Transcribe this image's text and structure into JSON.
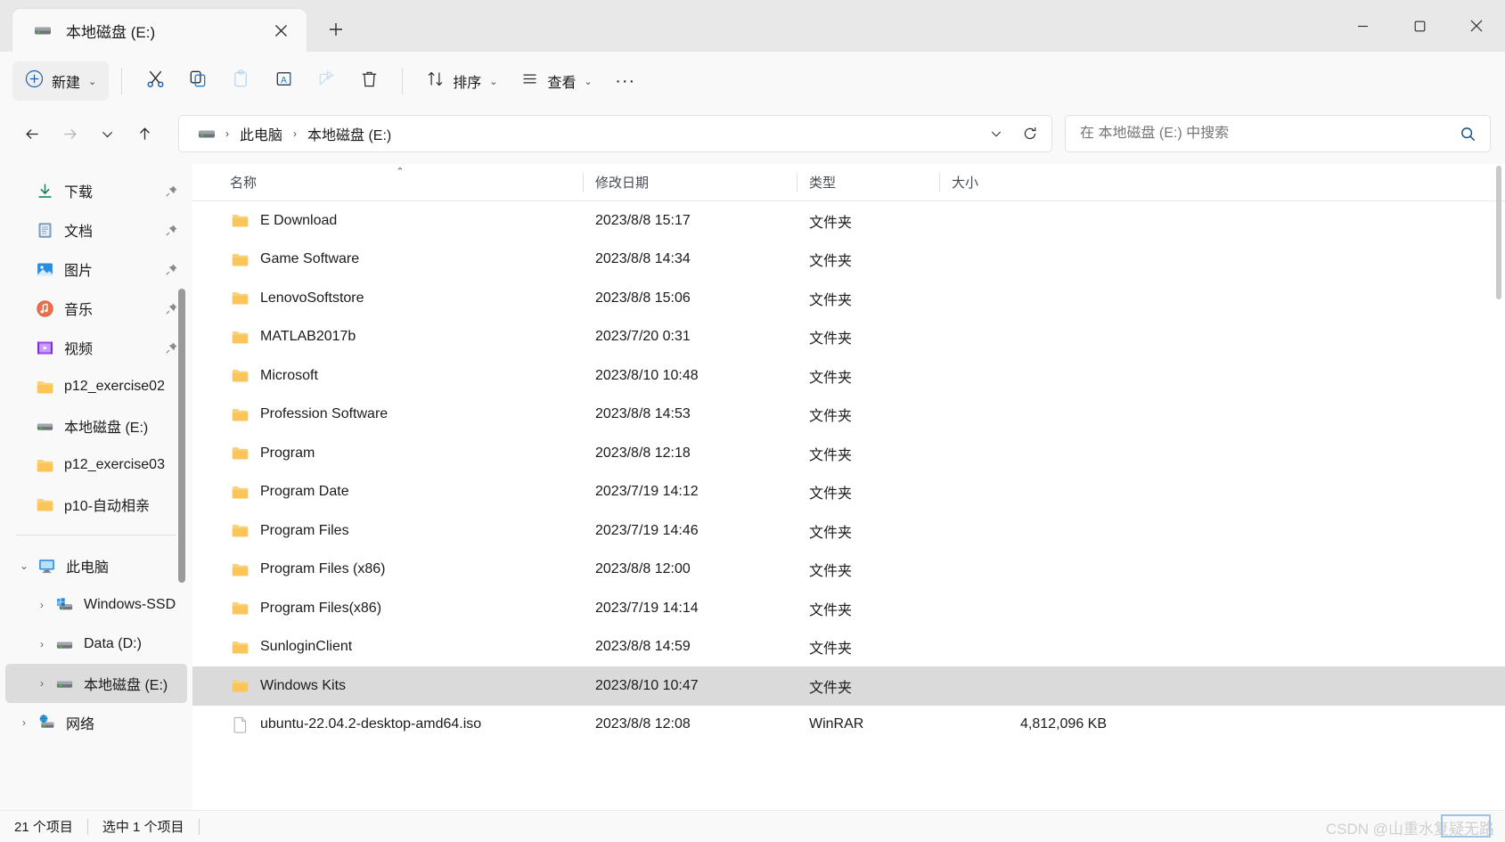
{
  "window": {
    "tab": {
      "title": "本地磁盘 (E:)",
      "icon": "drive-icon",
      "close_label": "✕"
    },
    "new_tab_label": "+",
    "controls": {
      "minimize": "minimize-icon",
      "maximize": "maximize-icon",
      "close": "close-icon"
    }
  },
  "toolbar": {
    "new_label": "新建",
    "buttons": [
      {
        "name": "cut-button",
        "icon": "scissors-icon",
        "label": "剪切"
      },
      {
        "name": "copy-button",
        "icon": "copy-icon",
        "label": "复制"
      },
      {
        "name": "paste-button",
        "icon": "paste-icon",
        "label": "粘贴",
        "disabled": true
      },
      {
        "name": "rename-button",
        "icon": "rename-icon",
        "label": "重命名"
      },
      {
        "name": "share-button",
        "icon": "share-icon",
        "label": "共享",
        "disabled": true
      },
      {
        "name": "delete-button",
        "icon": "trash-icon",
        "label": "删除"
      }
    ],
    "sort_label": "排序",
    "view_label": "查看",
    "more_label": "···"
  },
  "navbar": {
    "back": "←",
    "forward": "→",
    "recent": "⌄",
    "up": "↑",
    "breadcrumbs": [
      {
        "label": "此电脑"
      },
      {
        "label": "本地磁盘 (E:)"
      }
    ],
    "breadcrumb_sep": "›",
    "dropdown": "⌄",
    "refresh": "refresh-icon"
  },
  "search": {
    "placeholder": "在 本地磁盘 (E:) 中搜索",
    "value": "",
    "icon": "search-icon"
  },
  "sidebar": {
    "quick_access": [
      {
        "label": "下载",
        "icon": "download-icon",
        "pinned": true
      },
      {
        "label": "文档",
        "icon": "documents-icon",
        "pinned": true
      },
      {
        "label": "图片",
        "icon": "pictures-icon",
        "pinned": true
      },
      {
        "label": "音乐",
        "icon": "music-icon",
        "pinned": true
      },
      {
        "label": "视频",
        "icon": "videos-icon",
        "pinned": true
      },
      {
        "label": "p12_exercise02",
        "icon": "folder-icon",
        "pinned": false
      },
      {
        "label": "本地磁盘 (E:)",
        "icon": "drive-icon",
        "pinned": false
      },
      {
        "label": "p12_exercise03",
        "icon": "folder-icon",
        "pinned": false
      },
      {
        "label": "p10-自动相亲",
        "icon": "folder-icon",
        "pinned": false
      }
    ],
    "tree": [
      {
        "label": "此电脑",
        "icon": "pc-icon",
        "expander": "⌄",
        "indent": 0,
        "selected": false
      },
      {
        "label": "Windows-SSD",
        "icon": "windows-drive-icon",
        "expander": "›",
        "indent": 1,
        "selected": false
      },
      {
        "label": "Data (D:)",
        "icon": "drive-icon",
        "expander": "›",
        "indent": 1,
        "selected": false
      },
      {
        "label": "本地磁盘 (E:)",
        "icon": "drive-icon",
        "expander": "›",
        "indent": 1,
        "selected": true
      },
      {
        "label": "网络",
        "icon": "network-icon",
        "expander": "›",
        "indent": 0,
        "selected": false
      }
    ]
  },
  "columns": [
    {
      "label": "名称",
      "sorted": "asc",
      "caret": "⌃"
    },
    {
      "label": "修改日期",
      "sorted": ""
    },
    {
      "label": "类型",
      "sorted": ""
    },
    {
      "label": "大小",
      "sorted": ""
    }
  ],
  "files": [
    {
      "name": "E Download",
      "date": "2023/8/8 15:17",
      "type": "文件夹",
      "size": "",
      "icon": "folder-icon",
      "selected": false
    },
    {
      "name": "Game Software",
      "date": "2023/8/8 14:34",
      "type": "文件夹",
      "size": "",
      "icon": "folder-icon",
      "selected": false
    },
    {
      "name": "LenovoSoftstore",
      "date": "2023/8/8 15:06",
      "type": "文件夹",
      "size": "",
      "icon": "folder-icon",
      "selected": false
    },
    {
      "name": "MATLAB2017b",
      "date": "2023/7/20 0:31",
      "type": "文件夹",
      "size": "",
      "icon": "folder-icon",
      "selected": false
    },
    {
      "name": "Microsoft",
      "date": "2023/8/10 10:48",
      "type": "文件夹",
      "size": "",
      "icon": "folder-icon",
      "selected": false
    },
    {
      "name": "Profession Software",
      "date": "2023/8/8 14:53",
      "type": "文件夹",
      "size": "",
      "icon": "folder-icon",
      "selected": false
    },
    {
      "name": "Program",
      "date": "2023/8/8 12:18",
      "type": "文件夹",
      "size": "",
      "icon": "folder-icon",
      "selected": false
    },
    {
      "name": "Program Date",
      "date": "2023/7/19 14:12",
      "type": "文件夹",
      "size": "",
      "icon": "folder-icon",
      "selected": false
    },
    {
      "name": "Program Files",
      "date": "2023/7/19 14:46",
      "type": "文件夹",
      "size": "",
      "icon": "folder-icon",
      "selected": false
    },
    {
      "name": "Program Files (x86)",
      "date": "2023/8/8 12:00",
      "type": "文件夹",
      "size": "",
      "icon": "folder-icon",
      "selected": false
    },
    {
      "name": "Program Files(x86)",
      "date": "2023/7/19 14:14",
      "type": "文件夹",
      "size": "",
      "icon": "folder-icon",
      "selected": false
    },
    {
      "name": "SunloginClient",
      "date": "2023/8/8 14:59",
      "type": "文件夹",
      "size": "",
      "icon": "folder-icon",
      "selected": false
    },
    {
      "name": "Windows Kits",
      "date": "2023/8/10 10:47",
      "type": "文件夹",
      "size": "",
      "icon": "folder-icon",
      "selected": true
    },
    {
      "name": "ubuntu-22.04.2-desktop-amd64.iso",
      "date": "2023/8/8 12:08",
      "type": "WinRAR",
      "size": "4,812,096 KB",
      "icon": "file-icon",
      "selected": false
    }
  ],
  "status": {
    "item_count": "21 个项目",
    "selection": "选中 1 个项目"
  },
  "watermark": "CSDN @山重水复疑无路"
}
